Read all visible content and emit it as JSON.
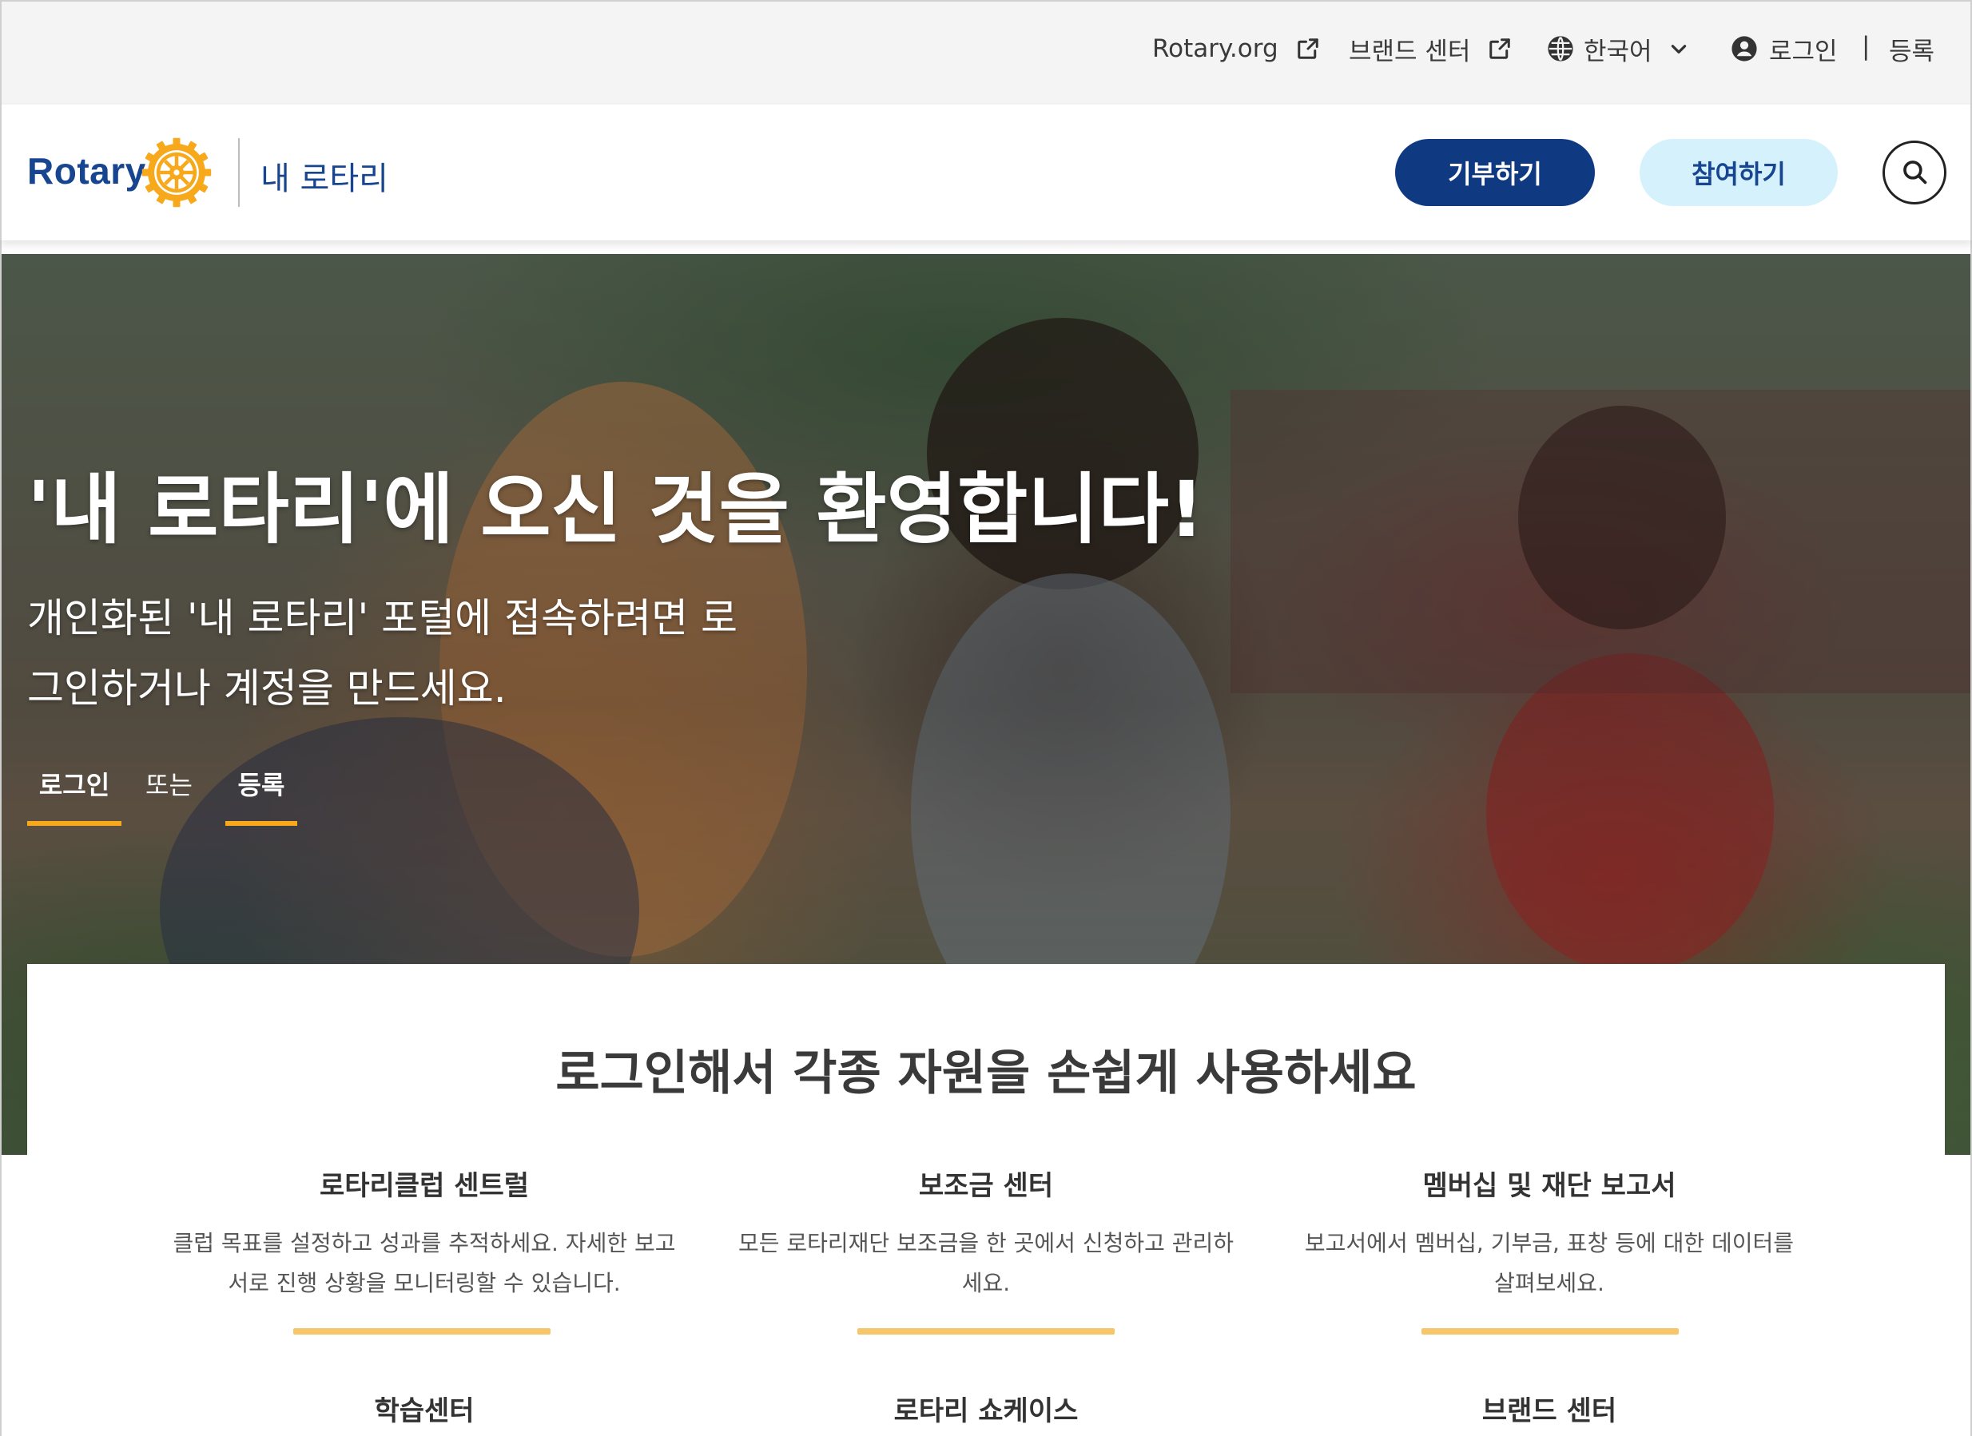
{
  "utility": {
    "rotary_org": "Rotary.org",
    "brand_center": "브랜드 센터",
    "language": "한국어",
    "login": "로그인",
    "separator": "|",
    "register": "등록"
  },
  "header": {
    "logo_text": "Rotary",
    "portal_name": "내 로타리",
    "donate_label": "기부하기",
    "join_label": "참여하기"
  },
  "hero": {
    "title": "'내 로타리'에 오신 것을 환영합니다!",
    "subtitle_line1": "개인화된 '내 로타리' 포털에 접속하려면 로",
    "subtitle_line2": "그인하거나 계정을 만드세요.",
    "login_link": "로그인",
    "or_text": "또는",
    "register_link": "등록"
  },
  "resources": {
    "heading": "로그인해서 각종 자원을 손쉽게 사용하세요",
    "features": [
      {
        "title": "로타리클럽 센트럴",
        "desc_line1": "클럽 목표를 설정하고 성과를 추적하세요. 자세한 보고",
        "desc_line2": "서로 진행 상황을 모니터링할 수 있습니다."
      },
      {
        "title": "보조금 센터",
        "desc_line1": "모든 로타리재단 보조금을 한 곳에서 신청하고 관리하",
        "desc_line2": "세요."
      },
      {
        "title": "멤버십 및 재단 보고서",
        "desc_line1": "보고서에서 멤버십, 기부금, 표창 등에 대한 데이터를",
        "desc_line2": "살펴보세요."
      }
    ],
    "more_features": [
      {
        "title": "학습센터"
      },
      {
        "title": "로타리 쇼케이스"
      },
      {
        "title": "브랜드 센터"
      }
    ]
  },
  "colors": {
    "rotary_blue": "#17458f",
    "donate_bg": "#0f3a82",
    "join_bg": "#d5f1fc",
    "gold": "#f7a81b",
    "accent_bar": "#f7c66b"
  },
  "icons": {
    "external_link": "external-link-icon",
    "globe": "globe-icon",
    "chevron": "chevron-down-icon",
    "user": "user-circle-icon",
    "search": "search-icon",
    "wheel": "rotary-wheel-logo"
  }
}
